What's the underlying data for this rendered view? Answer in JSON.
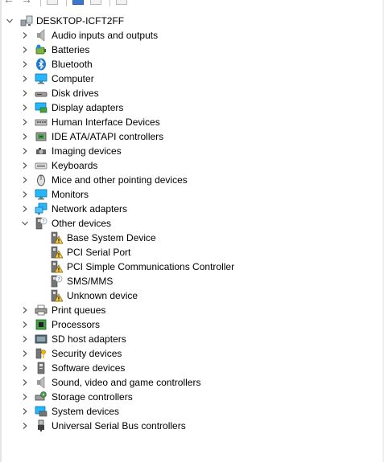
{
  "root": {
    "label": "DESKTOP-ICFT2FF",
    "expanded": true
  },
  "categories": [
    {
      "label": "Audio inputs and outputs",
      "icon": "speaker-icon",
      "expanded": false,
      "children": []
    },
    {
      "label": "Batteries",
      "icon": "battery-icon",
      "expanded": false,
      "children": []
    },
    {
      "label": "Bluetooth",
      "icon": "bluetooth-icon",
      "expanded": false,
      "children": []
    },
    {
      "label": "Computer",
      "icon": "computer-icon",
      "expanded": false,
      "children": []
    },
    {
      "label": "Disk drives",
      "icon": "disk-drive-icon",
      "expanded": false,
      "children": []
    },
    {
      "label": "Display adapters",
      "icon": "display-adapter-icon",
      "expanded": false,
      "children": []
    },
    {
      "label": "Human Interface Devices",
      "icon": "hid-icon",
      "expanded": false,
      "children": []
    },
    {
      "label": "IDE ATA/ATAPI controllers",
      "icon": "ide-controller-icon",
      "expanded": false,
      "children": []
    },
    {
      "label": "Imaging devices",
      "icon": "camera-icon",
      "expanded": false,
      "children": []
    },
    {
      "label": "Keyboards",
      "icon": "keyboard-icon",
      "expanded": false,
      "children": []
    },
    {
      "label": "Mice and other pointing devices",
      "icon": "mouse-icon",
      "expanded": false,
      "children": []
    },
    {
      "label": "Monitors",
      "icon": "monitor-icon",
      "expanded": false,
      "children": []
    },
    {
      "label": "Network adapters",
      "icon": "network-adapter-icon",
      "expanded": false,
      "children": []
    },
    {
      "label": "Other devices",
      "icon": "unknown-device-icon",
      "expanded": true,
      "children": [
        {
          "label": "Base System Device",
          "icon": "warning-device-icon"
        },
        {
          "label": "PCI Serial Port",
          "icon": "warning-device-icon"
        },
        {
          "label": "PCI Simple Communications Controller",
          "icon": "warning-device-icon"
        },
        {
          "label": "SMS/MMS",
          "icon": "unknown-device-icon"
        },
        {
          "label": "Unknown device",
          "icon": "warning-device-icon"
        }
      ]
    },
    {
      "label": "Print queues",
      "icon": "printer-icon",
      "expanded": false,
      "children": []
    },
    {
      "label": "Processors",
      "icon": "processor-icon",
      "expanded": false,
      "children": []
    },
    {
      "label": "SD host adapters",
      "icon": "sd-adapter-icon",
      "expanded": false,
      "children": []
    },
    {
      "label": "Security devices",
      "icon": "security-key-icon",
      "expanded": false,
      "children": []
    },
    {
      "label": "Software devices",
      "icon": "software-device-icon",
      "expanded": false,
      "children": []
    },
    {
      "label": "Sound, video and game controllers",
      "icon": "speaker-icon",
      "expanded": false,
      "children": []
    },
    {
      "label": "Storage controllers",
      "icon": "storage-controller-icon",
      "expanded": false,
      "children": []
    },
    {
      "label": "System devices",
      "icon": "system-device-icon",
      "expanded": false,
      "children": []
    },
    {
      "label": "Universal Serial Bus controllers",
      "icon": "usb-icon",
      "expanded": false,
      "children": []
    }
  ],
  "colors": {
    "accent_blue": "#1e78d4",
    "warning_yellow": "#f7c948",
    "expander_gray": "#5a5a5a"
  }
}
